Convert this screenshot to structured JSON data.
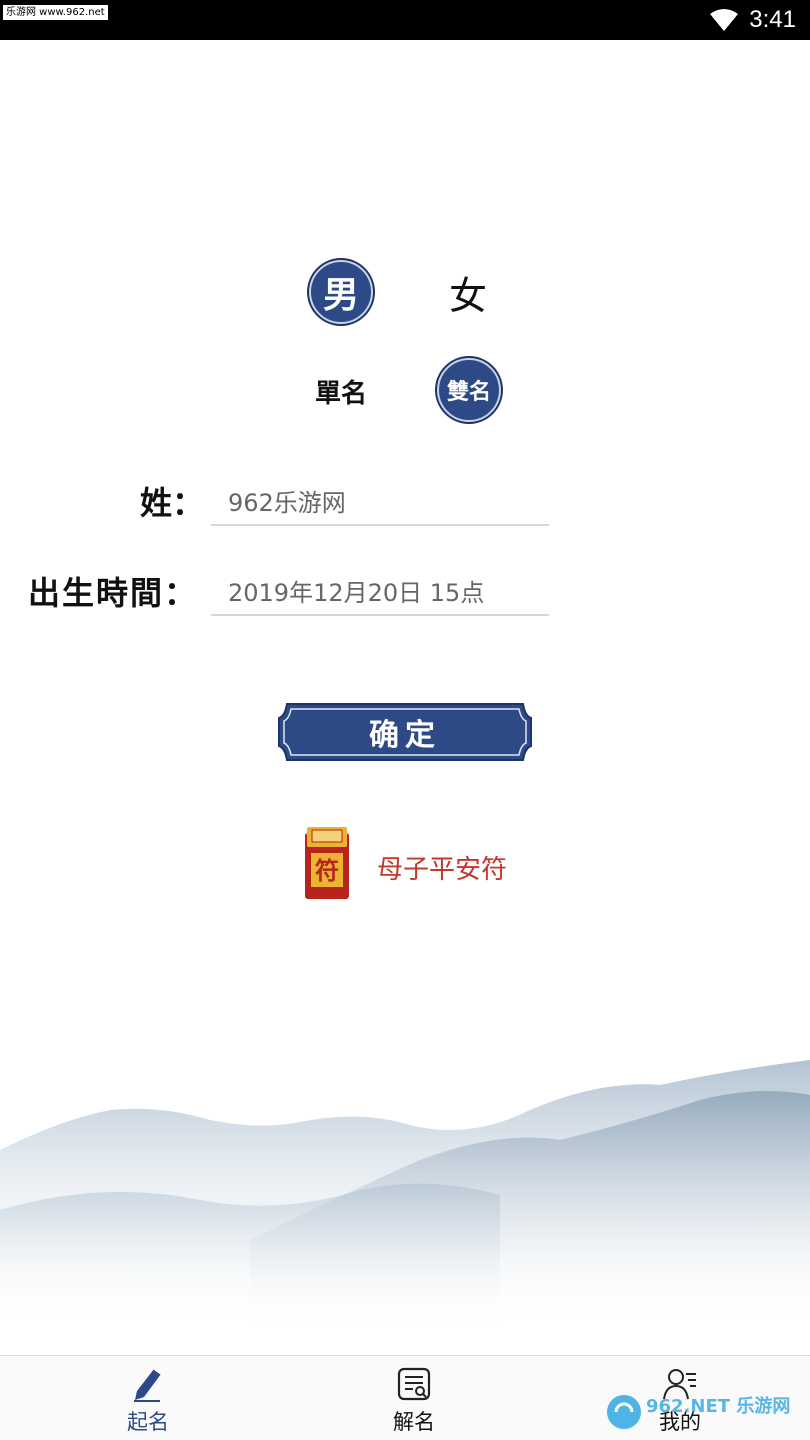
{
  "status_bar": {
    "watermark": "乐游网 www.962.net",
    "time": "3:41"
  },
  "gender": {
    "male": "男",
    "female": "女",
    "selected": "male"
  },
  "name_length": {
    "single": "單名",
    "double": "雙名",
    "selected": "double"
  },
  "form": {
    "surname_label": "姓：",
    "surname_value": "962乐游网",
    "birth_label": "出生時間：",
    "birth_value": "2019年12月20日 15点"
  },
  "confirm_label": "确定",
  "talisman": {
    "badge": "符",
    "label": "母子平安符"
  },
  "tabs": [
    {
      "label": "起名",
      "icon": "pen-icon",
      "active": true
    },
    {
      "label": "解名",
      "icon": "document-search-icon",
      "active": false
    },
    {
      "label": "我的",
      "icon": "user-icon",
      "active": false
    }
  ],
  "brand_watermark": "962.NET 乐游网",
  "colors": {
    "primary_blue": "#2d4a86",
    "talisman_red": "#c0392b",
    "mountain": "#9fb3c6"
  }
}
